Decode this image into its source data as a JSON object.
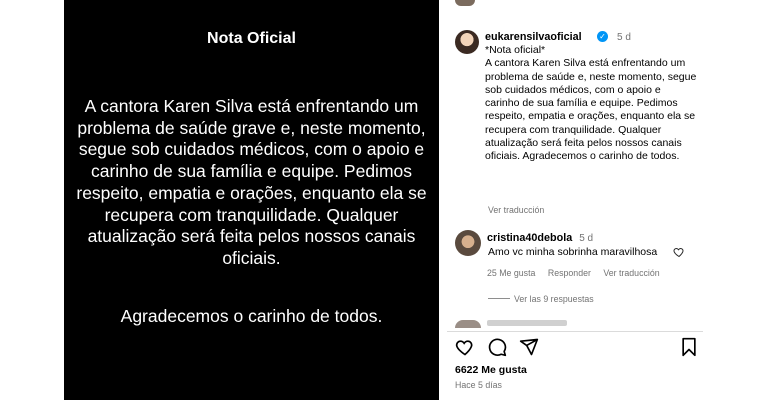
{
  "post": {
    "title": "Nota Oficial",
    "body": "A cantora Karen Silva está enfrentando um problema de saúde grave e, neste momento, segue sob cuidados médicos, com o apoio e carinho de sua família e equipe. Pedimos respeito, empatia e orações, enquanto ela se recupera com tranquilidade. Qualquer atualização será feita pelos nossos canais oficiais.",
    "thanks": "Agradecemos o carinho de todos."
  },
  "caption": {
    "username": "eukarensilvaoficial",
    "verified_glyph": "✓",
    "time": "5 d",
    "line1": "*Nota oficial*",
    "text": "A cantora Karen Silva está enfrentando um problema de saúde e, neste momento, segue sob cuidados médicos, com o apoio e carinho de sua família e equipe. Pedimos respeito, empatia e orações, enquanto ela se recupera com tranquilidade. Qualquer atualização será feita pelos nossos canais oficiais. Agradecemos o carinho de todos.",
    "translate": "Ver traducción"
  },
  "comment": {
    "username": "cristina40debola",
    "time": "5 d",
    "text": "Amo vc minha sobrinha maravilhosa",
    "likes": "25 Me gusta",
    "reply": "Responder",
    "translate": "Ver traducción",
    "view_replies": "Ver las 9 respuestas"
  },
  "footer": {
    "likes": "6622 Me gusta",
    "ago": "Hace 5 días"
  },
  "icons": {
    "like": "heart-icon",
    "comment": "comment-icon",
    "share": "share-icon",
    "save": "bookmark-icon",
    "verified": "verified-badge-icon"
  },
  "colors": {
    "verified": "#0095f6",
    "secondary_text": "#737373",
    "image_bg": "#000000"
  }
}
